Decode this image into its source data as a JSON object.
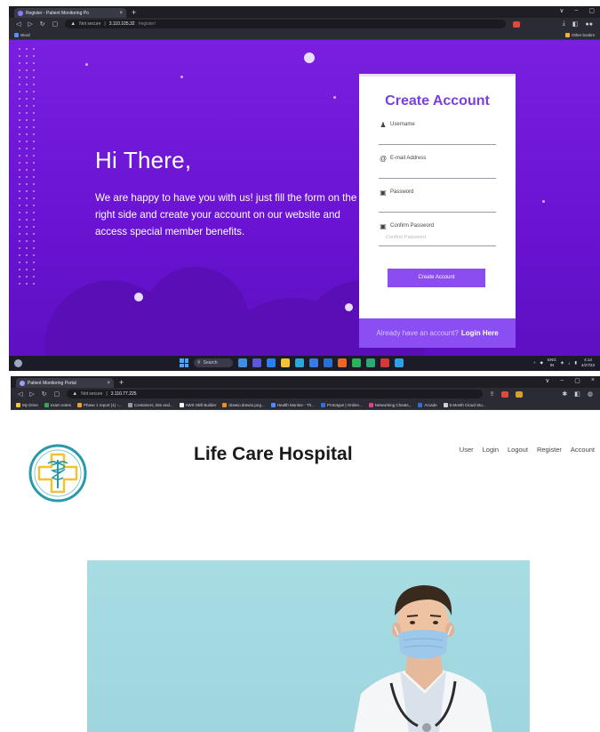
{
  "register_screen": {
    "browser": {
      "tab_title": "Register - Patient Monitoring Po",
      "tab_close": "×",
      "new_tab": "+",
      "window_controls": [
        "∨",
        "–",
        "▢"
      ],
      "security_label": "Not secure",
      "url_host": "3.110.105.32",
      "url_path": "/register/",
      "bookmarks": [
        {
          "label": "Word",
          "color": "#5a8cff"
        }
      ],
      "bookmark_right": {
        "label": "Other bookm",
        "color": "#e8b43a"
      }
    },
    "hero": {
      "title": "Hi There,",
      "text": "We are happy to have you with us! just fill the form on the right side and create your account on our website and access special member benefits."
    },
    "form": {
      "title": "Create Account",
      "fields": [
        {
          "icon": "user-icon",
          "label": "Username",
          "value": "",
          "placeholder": ""
        },
        {
          "icon": "at-icon",
          "label": "E-mail Address",
          "value": "",
          "placeholder": ""
        },
        {
          "icon": "lock-icon",
          "label": "Password",
          "value": "",
          "placeholder": ""
        },
        {
          "icon": "lock-icon",
          "label": "Confirm Password",
          "value": "",
          "placeholder": "Confirm Password"
        }
      ],
      "submit_label": "Create Account",
      "footer_question": "Already have an account?",
      "footer_link": "Login Here"
    },
    "taskbar": {
      "search_label": "Search",
      "lang_top": "ENG",
      "lang_bottom": "IN",
      "time": "4:14",
      "date": "4/27/23"
    },
    "colors": {
      "accent": "#7a3fe0",
      "background": "#6a1bd0",
      "button": "#8b4cf0"
    }
  },
  "hospital_screen": {
    "browser": {
      "tab_title": "Patient Monitoring Portal",
      "tab_close": "×",
      "new_tab": "+",
      "window_controls": [
        "∨",
        "–",
        "▢",
        "×"
      ],
      "security_label": "Not secure",
      "url_host": "3.110.77.225",
      "bookmarks": [
        {
          "label": "My Drive",
          "color": "#f5c542"
        },
        {
          "label": "exam notes",
          "color": "#3aa55a"
        },
        {
          "label": "Phase 1 report (1) -...",
          "color": "#f0a030"
        },
        {
          "label": "Containers, k8s and...",
          "color": "#9a9aa6"
        },
        {
          "label": "AWS Skill Builder",
          "color": "#ffffff"
        },
        {
          "label": "drawio.drawio.png...",
          "color": "#f08a24"
        },
        {
          "label": "Health Monitor - Th...",
          "color": "#4a8cff"
        },
        {
          "label": "Prototype | Online...",
          "color": "#2f6fe0"
        },
        {
          "label": "Networking Cheats...",
          "color": "#e0408a"
        },
        {
          "label": "Arcade",
          "color": "#3a6ad0"
        },
        {
          "label": "6 Month Cloud Stu...",
          "color": "#cfcfd8"
        }
      ]
    },
    "brand": "Life Care Hospital",
    "nav": [
      "User",
      "Login",
      "Logout",
      "Register",
      "Account"
    ],
    "colors": {
      "logo_ring": "#2a9aa8",
      "logo_cross": "#f2c230",
      "hero_bg": "#a7dce3"
    }
  }
}
